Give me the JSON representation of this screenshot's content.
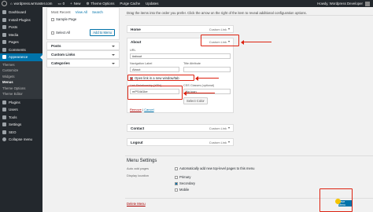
{
  "adminbar": {
    "site": "wordpress.wrmaster.com",
    "comments": "0",
    "new_label": "New",
    "theme_options": "Theme Options",
    "purge_cache": "Purge Cache",
    "updates": "Updates",
    "greeting": "Howdy, Wordpress Developer"
  },
  "sidebar": {
    "items_top": [
      {
        "label": "Dashboard",
        "icon": "dashboard-icon"
      },
      {
        "label": "Install Plugins",
        "icon": "plugin-icon"
      },
      {
        "label": "Posts",
        "icon": "pin-icon"
      },
      {
        "label": "Media",
        "icon": "media-icon"
      },
      {
        "label": "Pages",
        "icon": "page-icon"
      },
      {
        "label": "Comments",
        "icon": "comment-icon"
      }
    ],
    "active": {
      "label": "Appearance",
      "icon": "brush-icon"
    },
    "submenu": [
      "Themes",
      "Customize",
      "Widgets",
      "Menus",
      "Theme Options",
      "Theme Editor"
    ],
    "current": "Menus",
    "items_bottom": [
      {
        "label": "Plugins",
        "icon": "plugin-icon"
      },
      {
        "label": "Users",
        "icon": "users-icon"
      },
      {
        "label": "Tools",
        "icon": "wrench-icon"
      },
      {
        "label": "Settings",
        "icon": "settings-icon"
      },
      {
        "label": "SEO",
        "icon": "seo-icon"
      },
      {
        "label": "Collapse menu",
        "icon": "collapse-icon"
      }
    ]
  },
  "left": {
    "tab_recent": "Most Recent",
    "tab_view_all": "View All",
    "tab_search": "Search",
    "sample_page": "Sample Page",
    "select_all": "Select All",
    "add_to_menu": "Add to Menu",
    "sections": [
      "Posts",
      "Custom Links",
      "Categories"
    ]
  },
  "main": {
    "hint": "Drag the items into the order you prefer. Click the arrow on the right of the item to reveal additional configuration options.",
    "home": {
      "title": "Home",
      "type": "Custom Link"
    },
    "about": {
      "title": "About",
      "type": "Custom Link"
    },
    "url_label": "URL",
    "url_value": "#about",
    "nav_label": "Navigation Label",
    "nav_value": "About",
    "title_attr_label": "Title Attribute",
    "new_window": "Open link in a new window/tab",
    "rel_label": "Link Relationship (XFN)",
    "rel_value": "mPS4d1ke",
    "css_label": "CSS Classes (optional)",
    "css_value": "No icon",
    "select_color": "Select Color",
    "remove": "Remove",
    "cancel": "Cancel",
    "contact": {
      "title": "Contact",
      "type": "Custom Link"
    },
    "logout": {
      "title": "Logout",
      "type": "Custom Link"
    },
    "settings_title": "Menu Settings",
    "auto_add_label": "Auto add pages",
    "auto_add_text": "Automatically add new top-level pages to this menu",
    "display_label": "Display location",
    "locations": [
      "Primary",
      "Secondary",
      "Mobile"
    ],
    "delete_menu": "Delete Menu",
    "save_menu": "Save Menu"
  }
}
